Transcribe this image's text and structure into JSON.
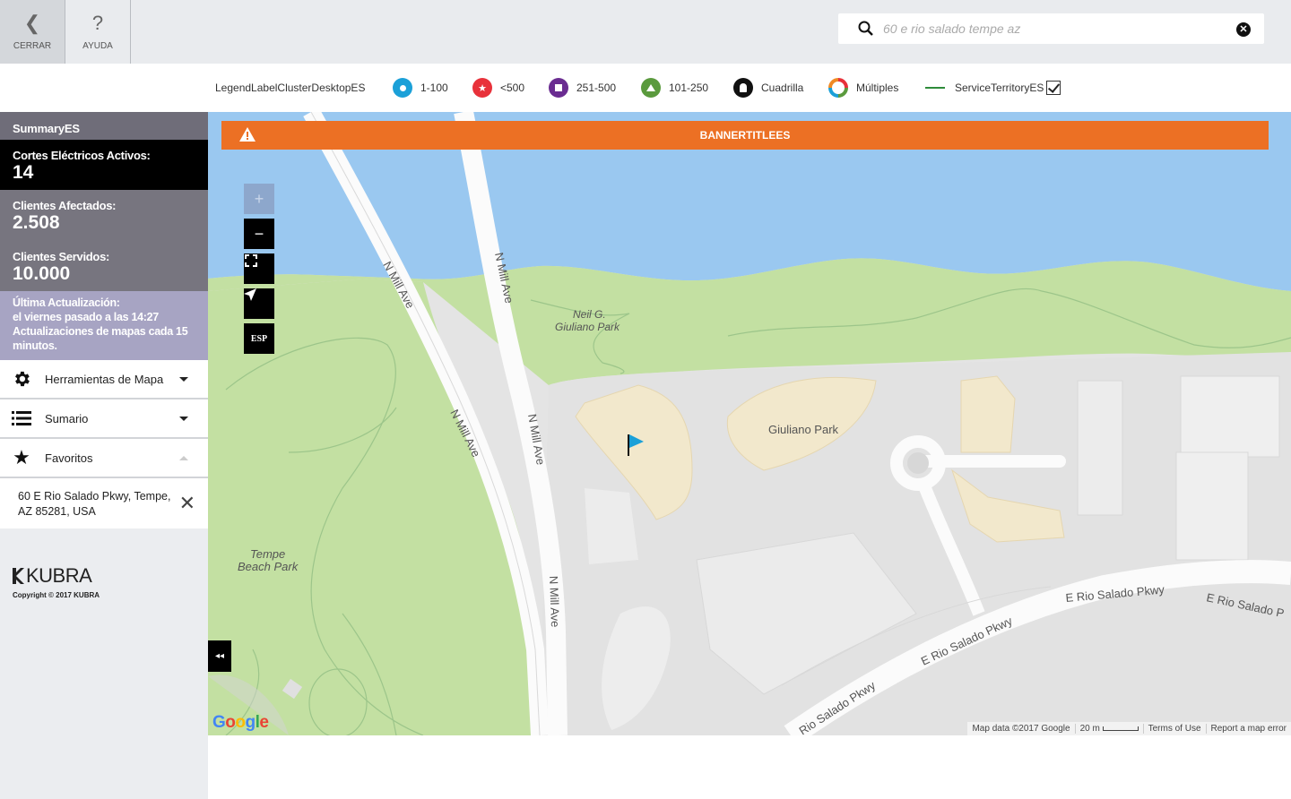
{
  "topbar": {
    "close_label": "CERRAR",
    "help_label": "AYUDA",
    "search_placeholder": "60 e rio salado tempe az"
  },
  "legend": {
    "title": "LegendLabelClusterDesktopES",
    "items": [
      {
        "label": "1-100",
        "color": "#1ba0d8",
        "icon": "circle-dot-icon"
      },
      {
        "label": "<500",
        "color": "#e8313a",
        "icon": "star-icon"
      },
      {
        "label": "251-500",
        "color": "#6a2c91",
        "icon": "square-icon"
      },
      {
        "label": "101-250",
        "color": "#5a9a3d",
        "icon": "triangle-icon"
      },
      {
        "label": "Cuadrilla",
        "color": "#111111",
        "icon": "crew-icon"
      },
      {
        "label": "Múltiples",
        "color": "#e8313a",
        "icon": "multi-ring-icon"
      },
      {
        "label": "ServiceTerritoryES",
        "color": "#2e8b3a",
        "icon": "line-icon",
        "checked": true
      }
    ]
  },
  "sidebar": {
    "summary_title": "SummaryES",
    "active_outages_label": "Cortes Eléctricos Activos:",
    "active_outages_value": "14",
    "affected_label": "Clientes Afectados:",
    "affected_value": "2.508",
    "served_label": "Clientes Servidos:",
    "served_value": "10.000",
    "update_label": "Última Actualización:",
    "update_time": "el viernes pasado a las 14:27",
    "update_freq": "Actualizaciones de mapas cada 15 minutos.",
    "menu": [
      {
        "label": "Herramientas de Mapa",
        "icon": "gear-icon"
      },
      {
        "label": "Sumario",
        "icon": "list-icon"
      },
      {
        "label": "Favoritos",
        "icon": "star-icon"
      }
    ],
    "favorite_address": "60 E Rio Salado Pkwy, Tempe, AZ 85281, USA",
    "brand": "KUBRA",
    "copyright": "Copyright © 2017 KUBRA"
  },
  "map": {
    "banner": "BANNERTITLEES",
    "language_button": "ESP",
    "google": "Google",
    "attribution": [
      "Map data ©2017 Google",
      "20 m",
      "Terms of Use",
      "Report a map error"
    ],
    "labels": {
      "mill": "N Mill Ave",
      "neil1": "Neil G.",
      "neil2": "Giuliano Park",
      "giuliano": "Giuliano Park",
      "tempe1": "Tempe",
      "tempe2": "Beach Park",
      "rio": "E Rio Salado Pkwy",
      "rio_partial1": "E Rio Salado P",
      "rio_partial2": "Rio Salado Pkwy"
    },
    "colors": {
      "water": "#9ac8f0",
      "park": "#c3e0a2",
      "building": "#f2e8cc",
      "banner": "#ec7024"
    }
  }
}
